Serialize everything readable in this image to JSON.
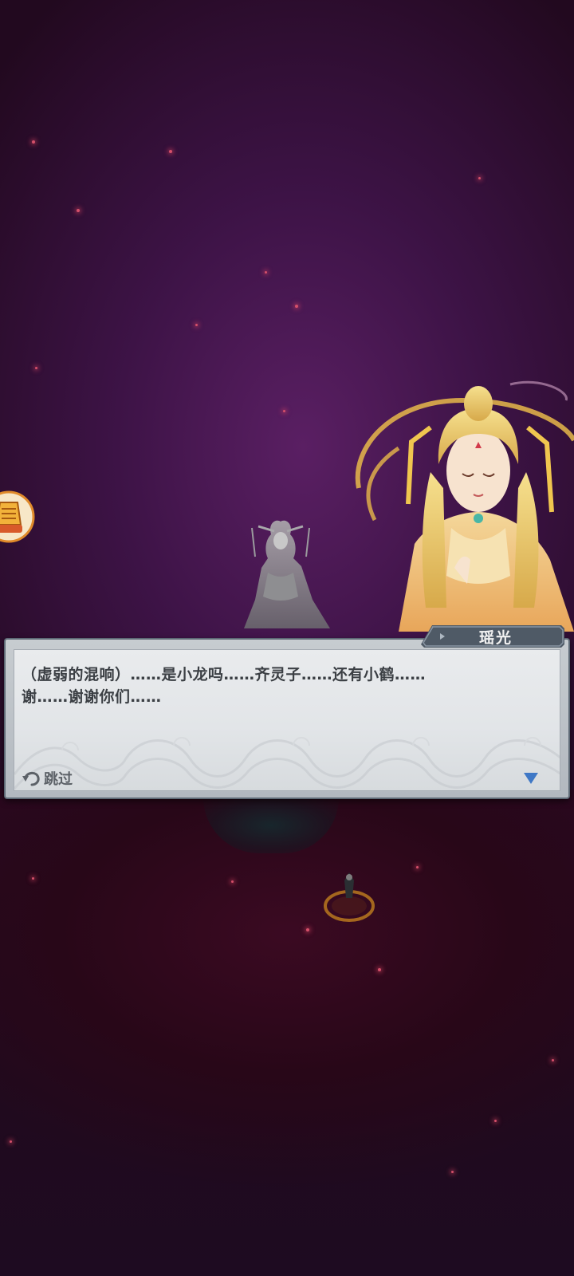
{
  "dialogue": {
    "speaker": "瑶光",
    "lines": [
      "（虚弱的混响）……是小龙吗……齐灵子……还有小鹤……",
      "谢……谢谢你们……"
    ]
  },
  "controls": {
    "skip_label": "跳过",
    "skip_icon": "undo-arrow-icon",
    "next_icon": "triangle-down-icon"
  },
  "colors": {
    "background": "#3d1346",
    "dialog_panel": "#e2e5e8",
    "name_tab": "#4f5a66",
    "next_arrow": "#3f78c6",
    "dialog_text": "#3b3f44"
  }
}
